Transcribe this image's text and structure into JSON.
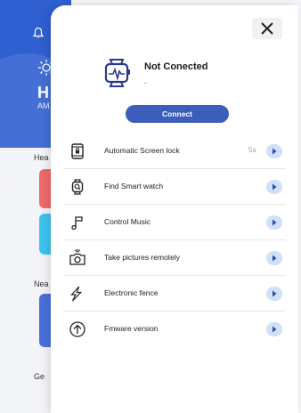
{
  "background": {
    "header_big_text": "H",
    "header_small_text": "AM",
    "labels": [
      "Hea",
      "Nea",
      "Ge"
    ]
  },
  "device": {
    "status_title": "Not Conected",
    "status_subtitle": "-",
    "connect_label": "Connect"
  },
  "menu": [
    {
      "label": "Automatic Screen lock",
      "value": "5s",
      "icon": "screen-lock-icon"
    },
    {
      "label": "Find Smart watch",
      "value": "",
      "icon": "find-watch-icon"
    },
    {
      "label": "Control Music",
      "value": "",
      "icon": "music-note-icon"
    },
    {
      "label": "Take pictures remotely",
      "value": "",
      "icon": "remote-camera-icon"
    },
    {
      "label": "Electronic fence",
      "value": "",
      "icon": "electronic-fence-icon"
    },
    {
      "label": "Fmware version",
      "value": "",
      "icon": "firmware-upgrade-icon"
    }
  ],
  "colors": {
    "primary": "#3d5dbd",
    "header_blue": "#2f5fd0",
    "chevron_bg": "#cfe0f7",
    "chevron_fg": "#2e4fae"
  }
}
